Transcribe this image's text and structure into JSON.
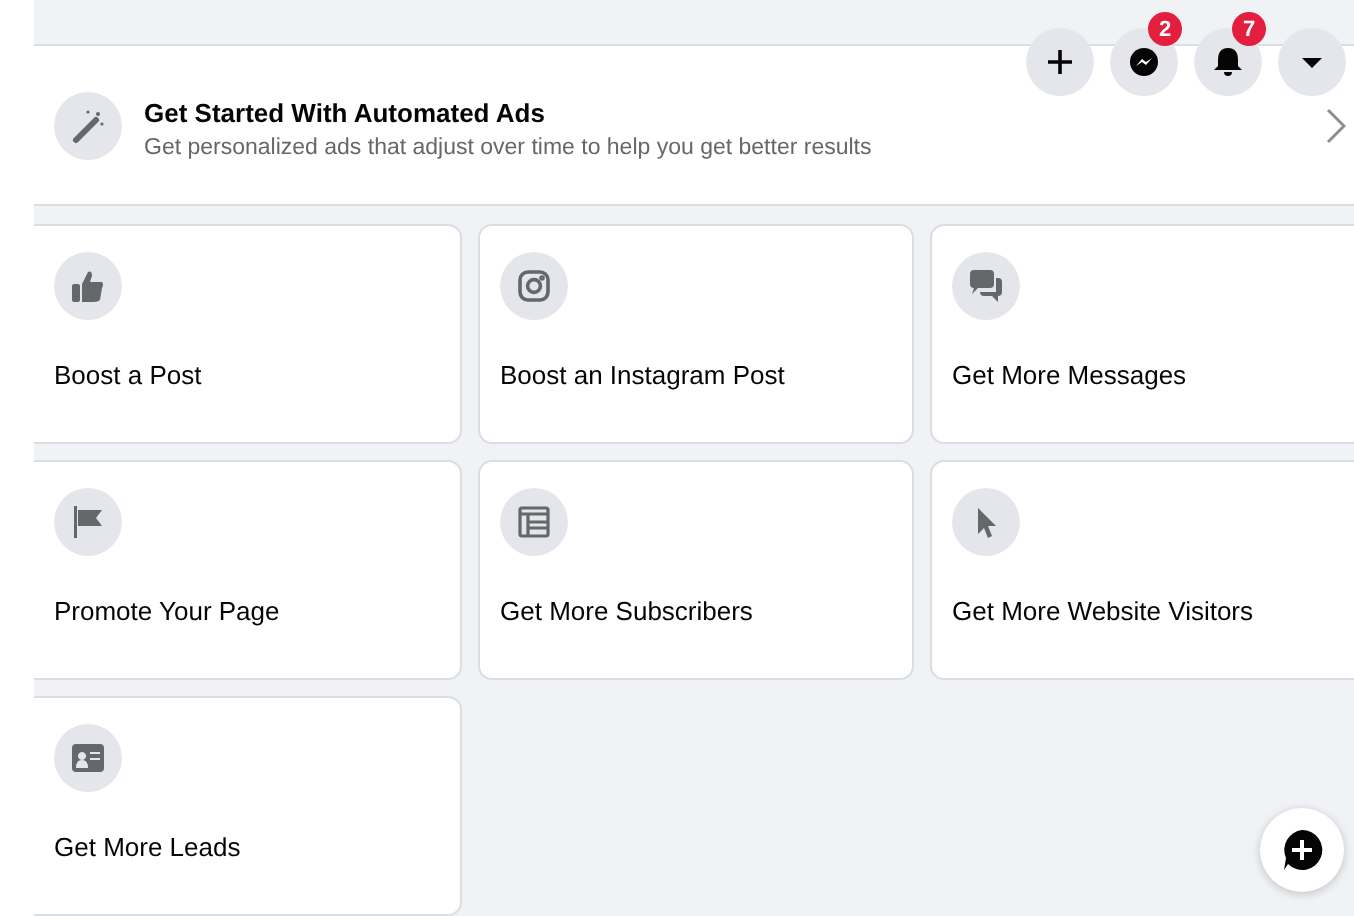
{
  "top_buttons": [
    {
      "kind": "plus"
    },
    {
      "kind": "messenger",
      "badge": "2"
    },
    {
      "kind": "bell",
      "badge": "7"
    },
    {
      "kind": "caret"
    }
  ],
  "banner": {
    "title": "Get Started With Automated Ads",
    "subtitle": "Get personalized ads that adjust over time to help you get better results"
  },
  "cards": [
    {
      "kind": "like",
      "label": "Boost a Post"
    },
    {
      "kind": "instagram",
      "label": "Boost an Instagram Post"
    },
    {
      "kind": "messages",
      "label": "Get More Messages"
    },
    {
      "kind": "flag",
      "label": "Promote Your Page"
    },
    {
      "kind": "subscribers",
      "label": "Get More Subscribers"
    },
    {
      "kind": "cursor",
      "label": "Get More Website Visitors"
    },
    {
      "kind": "leads",
      "label": "Get More Leads"
    }
  ]
}
